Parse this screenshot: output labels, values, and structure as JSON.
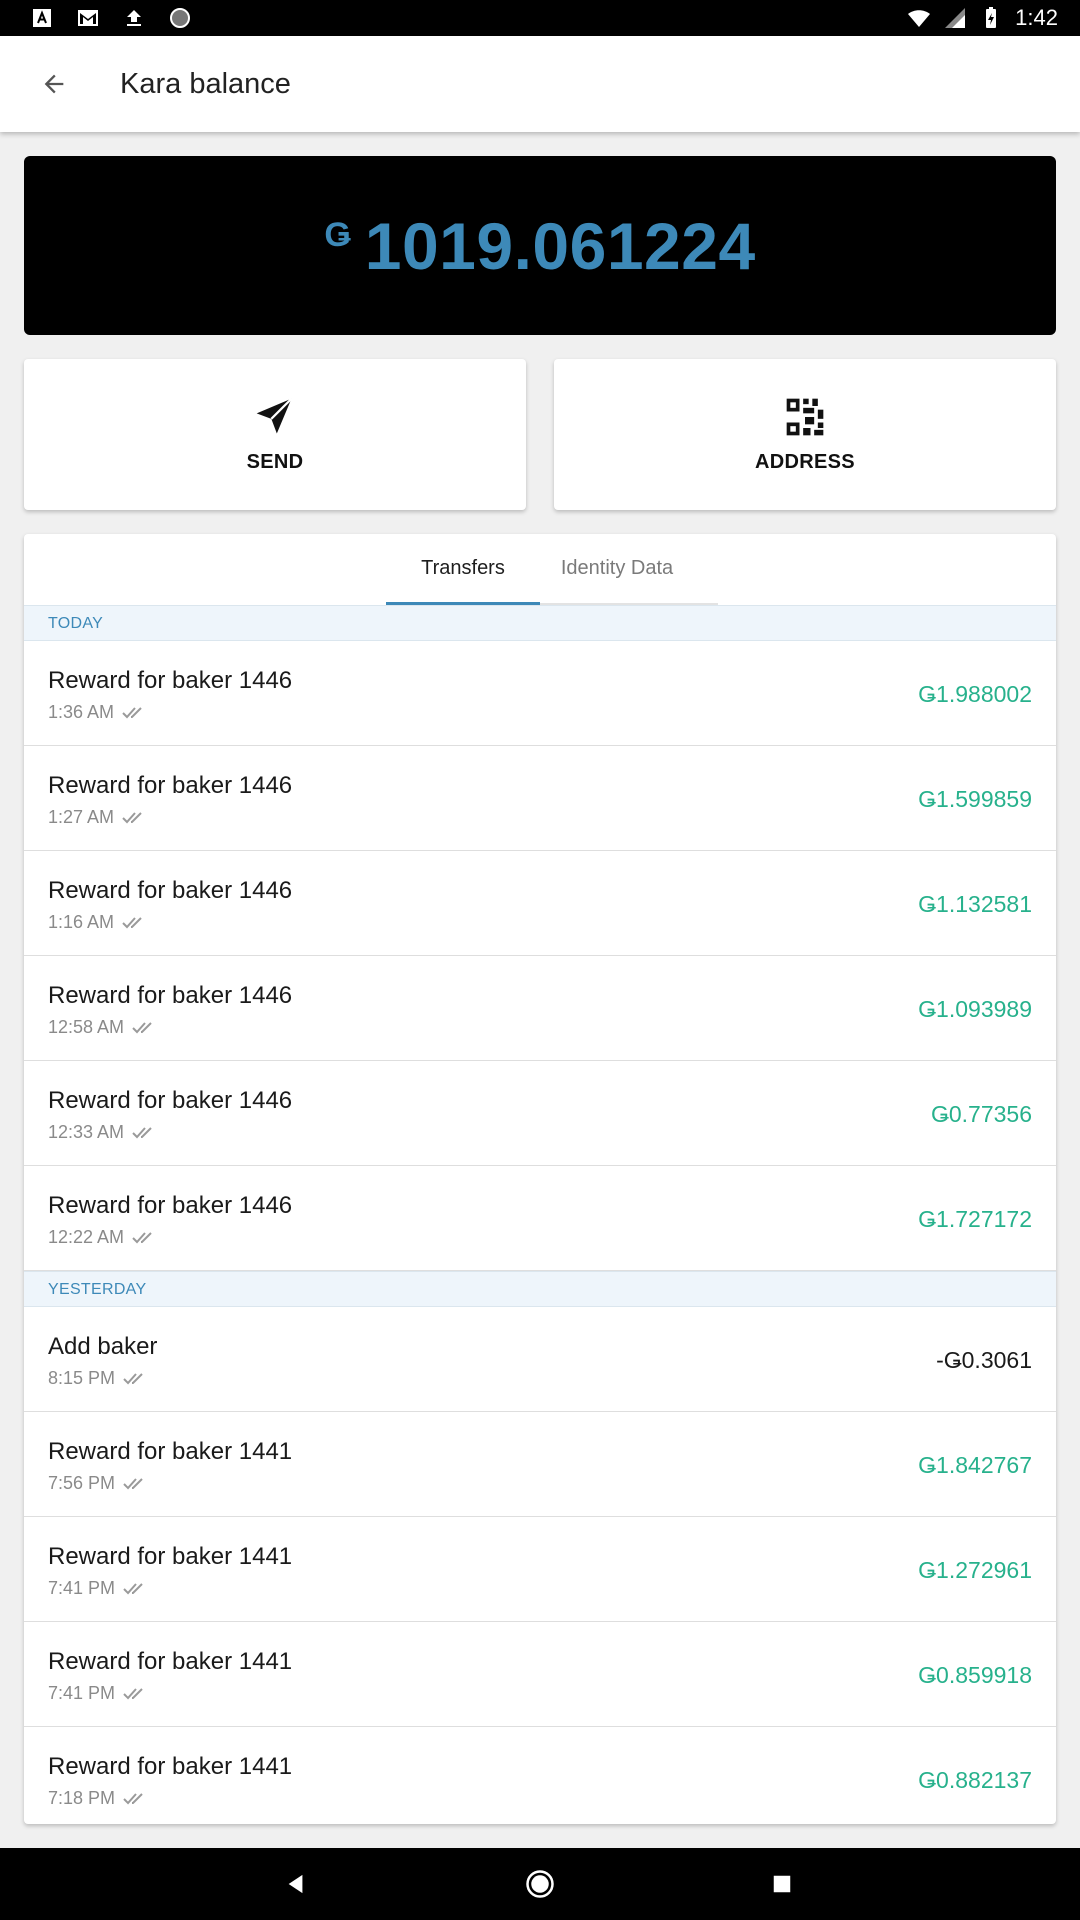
{
  "status_bar": {
    "time": "1:42",
    "left_icons": [
      "text-a-icon",
      "gmail-icon",
      "upload-icon",
      "circle-icon"
    ],
    "right_icons": [
      "wifi-icon",
      "signal-icon",
      "battery-icon"
    ]
  },
  "app_bar": {
    "back_icon": "arrow-left-icon",
    "title": "Kara balance"
  },
  "balance": {
    "currency_symbol": "Ǥ",
    "amount": "1019.061224",
    "color": "#3d89b8"
  },
  "actions": {
    "send_label": "SEND",
    "send_icon": "paper-plane-icon",
    "address_label": "ADDRESS",
    "address_icon": "qr-code-icon"
  },
  "tabs": [
    {
      "label": "Transfers",
      "active": true
    },
    {
      "label": "Identity Data",
      "active": false
    }
  ],
  "sections": [
    {
      "header": "TODAY",
      "items": [
        {
          "title": "Reward for baker 1446",
          "time": "1:36 AM",
          "amount": "Ǥ1.988002"
        },
        {
          "title": "Reward for baker 1446",
          "time": "1:27 AM",
          "amount": "Ǥ1.599859"
        },
        {
          "title": "Reward for baker 1446",
          "time": "1:16 AM",
          "amount": "Ǥ1.132581"
        },
        {
          "title": "Reward for baker 1446",
          "time": "12:58 AM",
          "amount": "Ǥ1.093989"
        },
        {
          "title": "Reward for baker 1446",
          "time": "12:33 AM",
          "amount": "Ǥ0.77356"
        },
        {
          "title": "Reward for baker 1446",
          "time": "12:22 AM",
          "amount": "Ǥ1.727172"
        }
      ]
    },
    {
      "header": "YESTERDAY",
      "items": [
        {
          "title": "Add baker",
          "time": "8:15 PM",
          "amount": "-Ǥ0.3061"
        },
        {
          "title": "Reward for baker 1441",
          "time": "7:56 PM",
          "amount": "Ǥ1.842767"
        },
        {
          "title": "Reward for baker 1441",
          "time": "7:41 PM",
          "amount": "Ǥ1.272961"
        },
        {
          "title": "Reward for baker 1441",
          "time": "7:41 PM",
          "amount": "Ǥ0.859918"
        },
        {
          "title": "Reward for baker 1441",
          "time": "7:18 PM",
          "amount": "Ǥ0.882137"
        }
      ]
    }
  ],
  "colors": {
    "positive_amount": "#27b18c",
    "negative_amount": "#1a1a1a",
    "accent": "#3d89b8"
  },
  "nav_bar": {
    "icons": [
      "nav-back-icon",
      "nav-home-icon",
      "nav-recents-icon"
    ]
  }
}
